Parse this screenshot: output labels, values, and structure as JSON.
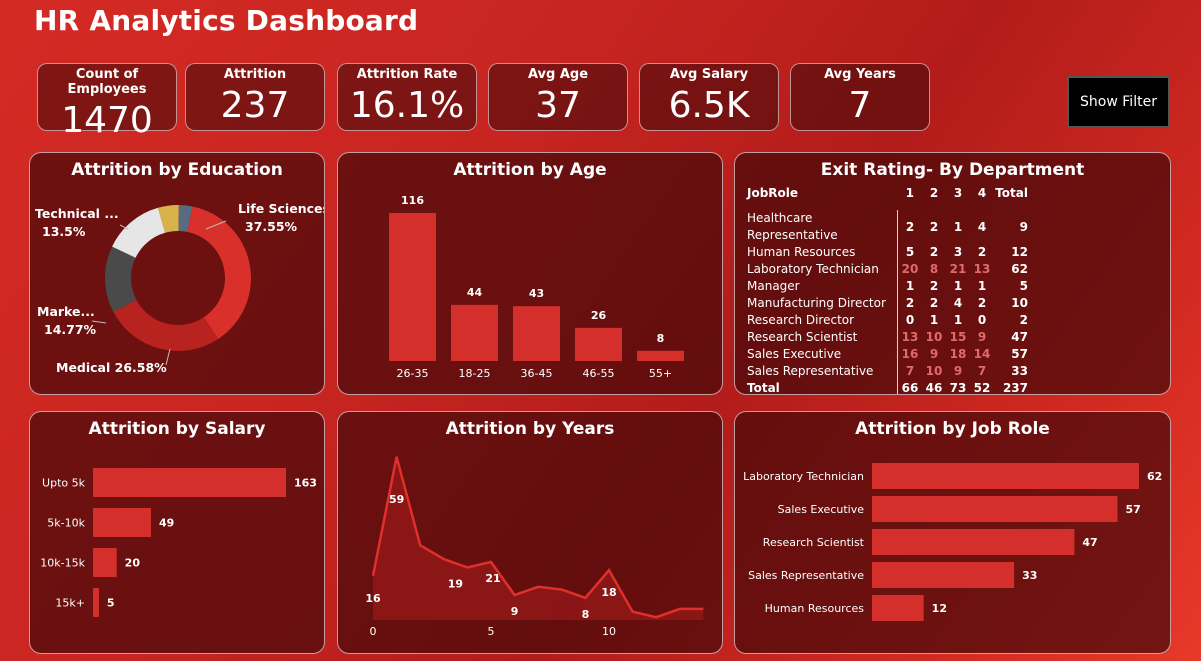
{
  "header": {
    "title": "HR Analytics Dashboard",
    "filter_button": "Show Filter"
  },
  "kpis": [
    {
      "label": "Count of Employees",
      "value": "1470"
    },
    {
      "label": "Attrition",
      "value": "237"
    },
    {
      "label": "Attrition Rate",
      "value": "16.1%"
    },
    {
      "label": "Avg Age",
      "value": "37"
    },
    {
      "label": "Avg Salary",
      "value": "6.5K"
    },
    {
      "label": "Avg Years",
      "value": "7"
    }
  ],
  "education": {
    "title": "Attrition by Education",
    "slices": [
      {
        "label": "Life Sciences",
        "pct": "37.55%",
        "value": 37.55,
        "color": "#d9302c"
      },
      {
        "label": "Medical",
        "pct": "26.58%",
        "value": 26.58,
        "color": "#b8221f"
      },
      {
        "label": "Marke...",
        "pct": "14.77%",
        "value": 14.77,
        "color": "#4a4a4a"
      },
      {
        "label": "Technical ...",
        "pct": "13.5%",
        "value": 13.5,
        "color": "#e6e6e6"
      },
      {
        "label": "",
        "pct": "",
        "value": 4.6,
        "color": "#d8b24a"
      },
      {
        "label": "",
        "pct": "",
        "value": 3.0,
        "color": "#5a6a80"
      }
    ]
  },
  "age": {
    "title": "Attrition by Age",
    "chart_data": {
      "type": "bar",
      "categories": [
        "26-35",
        "18-25",
        "36-45",
        "46-55",
        "55+"
      ],
      "values": [
        116,
        44,
        43,
        26,
        8
      ]
    }
  },
  "exit": {
    "title": "Exit Rating- By Department",
    "headers": [
      "JobRole",
      "1",
      "2",
      "3",
      "4",
      "Total"
    ],
    "rows": [
      {
        "name": "Healthcare Representative",
        "v": [
          "2",
          "2",
          "1",
          "4"
        ],
        "total": "9"
      },
      {
        "name": "Human Resources",
        "v": [
          "5",
          "2",
          "3",
          "2"
        ],
        "total": "12"
      },
      {
        "name": "Laboratory Technician",
        "v": [
          "20",
          "8",
          "21",
          "13"
        ],
        "total": "62"
      },
      {
        "name": "Manager",
        "v": [
          "1",
          "2",
          "1",
          "1"
        ],
        "total": "5"
      },
      {
        "name": "Manufacturing Director",
        "v": [
          "2",
          "2",
          "4",
          "2"
        ],
        "total": "10"
      },
      {
        "name": "Research Director",
        "v": [
          "0",
          "1",
          "1",
          "0"
        ],
        "total": "2"
      },
      {
        "name": "Research Scientist",
        "v": [
          "13",
          "10",
          "15",
          "9"
        ],
        "total": "47"
      },
      {
        "name": "Sales Executive",
        "v": [
          "16",
          "9",
          "18",
          "14"
        ],
        "total": "57"
      },
      {
        "name": "Sales Representative",
        "v": [
          "7",
          "10",
          "9",
          "7"
        ],
        "total": "33"
      }
    ],
    "total_row": {
      "name": "Total",
      "v": [
        "66",
        "46",
        "73",
        "52"
      ],
      "total": "237"
    }
  },
  "salary": {
    "title": "Attrition by Salary",
    "chart_data": {
      "type": "bar",
      "categories": [
        "Upto 5k",
        "5k-10k",
        "10k-15k",
        "15k+"
      ],
      "values": [
        163,
        49,
        20,
        5
      ]
    }
  },
  "years": {
    "title": "Attrition by Years",
    "chart_data": {
      "type": "area",
      "x": [
        0,
        1,
        2,
        3,
        4,
        5,
        6,
        7,
        8,
        9,
        10,
        11,
        12,
        13,
        14
      ],
      "values": [
        16,
        59,
        27,
        22,
        19,
        21,
        9,
        12,
        11,
        8,
        18,
        3,
        1,
        4,
        4
      ],
      "labeled": [
        0,
        1,
        4,
        5,
        6,
        9,
        10
      ],
      "xticks": [
        0,
        5,
        10
      ]
    }
  },
  "jobrole": {
    "title": "Attrition by Job Role",
    "chart_data": {
      "type": "bar",
      "categories": [
        "Laboratory Technician",
        "Sales Executive",
        "Research Scientist",
        "Sales Representative",
        "Human Resources"
      ],
      "values": [
        62,
        57,
        47,
        33,
        12
      ]
    }
  }
}
